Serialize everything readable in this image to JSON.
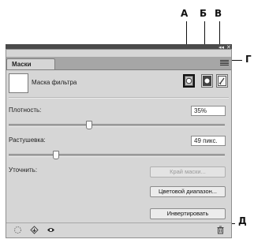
{
  "callouts": {
    "a": "А",
    "b": "Б",
    "v": "В",
    "g": "Г",
    "d": "Д"
  },
  "panel": {
    "tab_label": "Маски",
    "mask_title": "Маска фильтра",
    "density": {
      "label": "Плотность:",
      "value": "35%",
      "level": 0.35
    },
    "feather": {
      "label": "Растушевка:",
      "value": "49 пикс.",
      "level": 0.2
    },
    "refine_label": "Уточнить:",
    "buttons": {
      "mask_edge": "Край маски...",
      "color_range": "Цветовой диапазон...",
      "invert": "Инвертировать"
    }
  },
  "icons": {
    "pixel_mask": "pixel-mask-icon",
    "vector_mask": "vector-mask-icon",
    "filter_mask": "filter-mask-icon",
    "panel_menu": "panel-menu-icon",
    "load_selection": "load-selection-icon",
    "apply_mask": "apply-mask-icon",
    "toggle_mask": "eye-icon",
    "delete": "trash-icon"
  }
}
